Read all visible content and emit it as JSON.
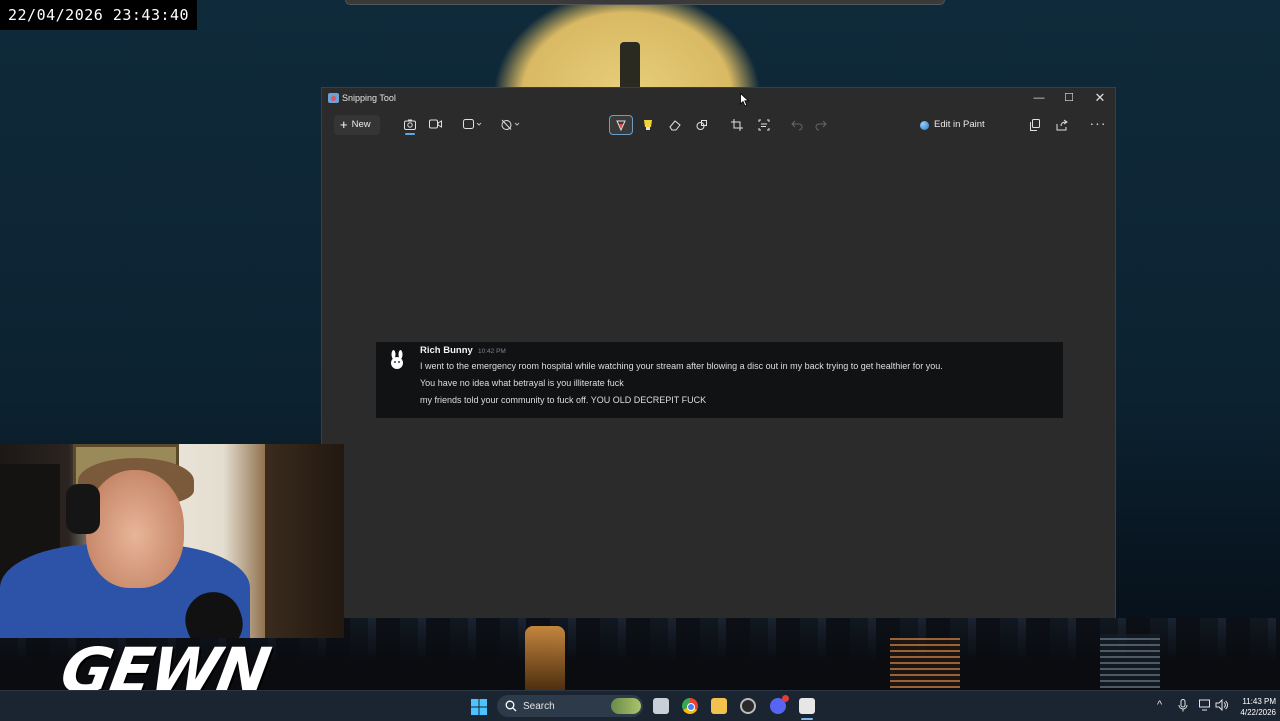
{
  "overlay": {
    "timestamp": "22/04/2026 23:43:40"
  },
  "window": {
    "title": "Snipping Tool",
    "controls": {
      "minimize": "—",
      "maximize": "☐",
      "close": "✕"
    }
  },
  "toolbar": {
    "new_label": "New",
    "new_icon": "plus-icon",
    "modes": [
      "camera-icon",
      "video-icon"
    ],
    "active_mode": "screenshot",
    "shape_select_icon": "rectangle-icon",
    "delay_icon": "timer-off-icon",
    "markup_tools": [
      "ballpoint-pen-icon",
      "highlighter-icon",
      "eraser-icon",
      "shapes-icon",
      "crop-icon",
      "text-actions-icon"
    ],
    "active_tool": "ballpoint-pen",
    "edit_in_paint_label": "Edit in Paint",
    "right_icons": [
      "copy-icon",
      "share-icon",
      "more-icon"
    ]
  },
  "message": {
    "author": "Rich Bunny",
    "time": "10:42 PM",
    "lines": [
      "I went to the emergency room hospital while watching your stream after blowing a disc out in my back trying to get healthier for you.",
      "You have no idea what betrayal is you illiterate fuck",
      "my friends told your community to fuck off. YOU OLD DECREPIT FUCK"
    ]
  },
  "overlay_brand": {
    "watermark": "GEWN"
  },
  "taskbar": {
    "search_label": "Search",
    "time": "11:43 PM",
    "date": "4/22/2026",
    "accent": "#7fb6ea",
    "discord_badge_color": "#e23b3b"
  },
  "colors": {
    "window_bg": "#2b2b2b",
    "message_bg": "#111214",
    "pen_accent": "#6a9ec9"
  }
}
